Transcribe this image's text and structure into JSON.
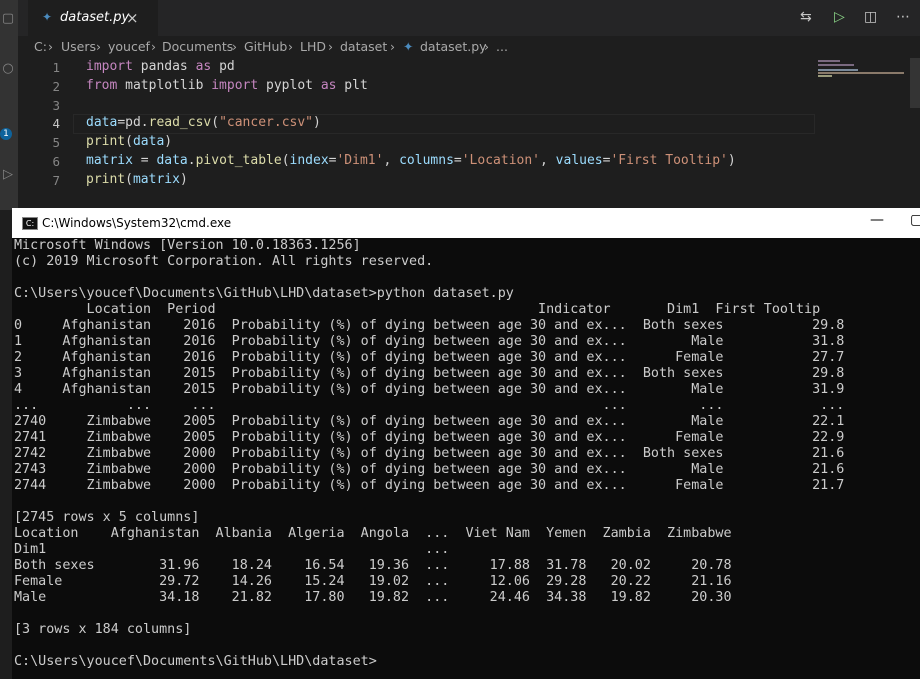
{
  "editor": {
    "tab": {
      "label": "dataset.py",
      "close": "×"
    },
    "breadcrumb": [
      "C:",
      "Users",
      "youcef",
      "Documents",
      "GitHub",
      "LHD",
      "dataset",
      "dataset.py",
      "..."
    ],
    "line_numbers": [
      "1",
      "2",
      "3",
      "4",
      "5",
      "6",
      "7"
    ]
  },
  "cmd": {
    "title": "C:\\Windows\\System32\\cmd.exe",
    "lines": [
      "Microsoft Windows [Version 10.0.18363.1256]",
      "(c) 2019 Microsoft Corporation. All rights reserved.",
      "",
      "C:\\Users\\youcef\\Documents\\GitHub\\LHD\\dataset>python dataset.py",
      "         Location  Period                                        Indicator       Dim1  First Tooltip",
      "0     Afghanistan    2016  Probability (%) of dying between age 30 and ex...  Both sexes           29.8",
      "1     Afghanistan    2016  Probability (%) of dying between age 30 and ex...        Male           31.8",
      "2     Afghanistan    2016  Probability (%) of dying between age 30 and ex...      Female           27.7",
      "3     Afghanistan    2015  Probability (%) of dying between age 30 and ex...  Both sexes           29.8",
      "4     Afghanistan    2015  Probability (%) of dying between age 30 and ex...        Male           31.9",
      "...           ...     ...                                                ...         ...            ...",
      "2740     Zimbabwe    2005  Probability (%) of dying between age 30 and ex...        Male           22.1",
      "2741     Zimbabwe    2005  Probability (%) of dying between age 30 and ex...      Female           22.9",
      "2742     Zimbabwe    2000  Probability (%) of dying between age 30 and ex...  Both sexes           21.6",
      "2743     Zimbabwe    2000  Probability (%) of dying between age 30 and ex...        Male           21.6",
      "2744     Zimbabwe    2000  Probability (%) of dying between age 30 and ex...      Female           21.7",
      "",
      "[2745 rows x 5 columns]",
      "Location    Afghanistan  Albania  Algeria  Angola  ...  Viet Nam  Yemen  Zambia  Zimbabwe",
      "Dim1                                               ...",
      "Both sexes        31.96    18.24    16.54   19.36  ...     17.88  31.78   20.02     20.78",
      "Female            29.72    14.26    15.24   19.02  ...     12.06  29.28   20.22     21.16",
      "Male              34.18    21.82    17.80   19.82  ...     24.46  34.38   19.82     20.30",
      "",
      "[3 rows x 184 columns]",
      "",
      "C:\\Users\\youcef\\Documents\\GitHub\\LHD\\dataset>"
    ]
  }
}
